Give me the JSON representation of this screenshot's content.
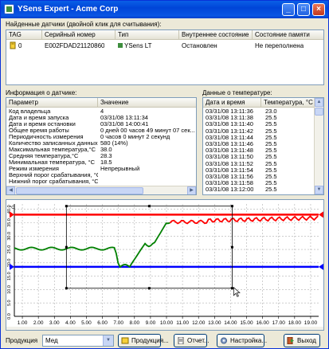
{
  "window": {
    "title": "YSens Expert - Acme Corp",
    "min": "_",
    "max": "□",
    "close": "×"
  },
  "sensors": {
    "label": "Найденные датчики (двойной клик для считывания):",
    "columns": [
      "TAG",
      "Серийный номер",
      "Тип",
      "Внутреннее состояние",
      "Состояние памяти"
    ],
    "row": {
      "tag": "0",
      "serial": "E002FDAD21120860",
      "type": "YSens LT",
      "state": "Остановлен",
      "memory": "Не переполнена"
    }
  },
  "info": {
    "label": "Информация о датчике:",
    "columns": [
      "Параметр",
      "Значение"
    ],
    "rows": [
      [
        "Код владельца",
        "4"
      ],
      [
        "Дата и время запуска",
        "03/31/08 13:11:34"
      ],
      [
        "Дата и время остановки",
        "03/31/08 14:00:41"
      ],
      [
        "Общее время работы",
        "0 дней 00 часов 49 минут 07 сек..."
      ],
      [
        "Периодичность измерения",
        "0 часов 0 минут 2 секунд"
      ],
      [
        "Количество записанных данных",
        "580 (14%)"
      ],
      [
        "Максимальная температура,°C",
        "38.0"
      ],
      [
        "Средняя температура,°C",
        "28.3"
      ],
      [
        "Минимальная температура, °C",
        "18.5"
      ],
      [
        "Режим измерения",
        "Непрерывный"
      ],
      [
        "Верхний порог срабатывания, °C",
        ""
      ],
      [
        "Нижний порог срабатывания, °C",
        ""
      ]
    ]
  },
  "temps": {
    "label": "Данные о температуре:",
    "columns": [
      "Дата и время",
      "Температура, °C"
    ],
    "rows": [
      [
        "03/31/08 13:11:36",
        "23.0"
      ],
      [
        "03/31/08 13:11:38",
        "25.5"
      ],
      [
        "03/31/08 13:11:40",
        "25.5"
      ],
      [
        "03/31/08 13:11:42",
        "25.5"
      ],
      [
        "03/31/08 13:11:44",
        "25.5"
      ],
      [
        "03/31/08 13:11:46",
        "25.5"
      ],
      [
        "03/31/08 13:11:48",
        "25.5"
      ],
      [
        "03/31/08 13:11:50",
        "25.5"
      ],
      [
        "03/31/08 13:11:52",
        "25.5"
      ],
      [
        "03/31/08 13:11:54",
        "25.5"
      ],
      [
        "03/31/08 13:11:56",
        "25.5"
      ],
      [
        "03/31/08 13:11:58",
        "25.5"
      ],
      [
        "03/31/08 13:12:00",
        "25.5"
      ]
    ]
  },
  "chart": {
    "y_unit": "°C",
    "y_ticks": [
      "40.0",
      "35.0",
      "30.0",
      "25.0",
      "20.0",
      "15.0",
      "10.0",
      "5.0",
      "0.0"
    ],
    "x_ticks": [
      "1.00",
      "2.00",
      "3.00",
      "4.00",
      "5.00",
      "6.00",
      "7.00",
      "8.00",
      "9.00",
      "10.00",
      "11.00",
      "12.00",
      "13.00",
      "14.00",
      "15.00",
      "16.00",
      "17.00",
      "18.00",
      "19.00"
    ],
    "upper_threshold": 38.0,
    "lower_threshold": 18.5,
    "colors": {
      "upper": "#ff0000",
      "lower": "#0000ff",
      "data_green": "#008000",
      "data_red": "#ff0000"
    }
  },
  "bottom": {
    "product_label": "Продукция",
    "product_value": "Мед",
    "buttons": [
      "Продукция...",
      "Отчет...",
      "Настройка...",
      "Выход"
    ]
  }
}
